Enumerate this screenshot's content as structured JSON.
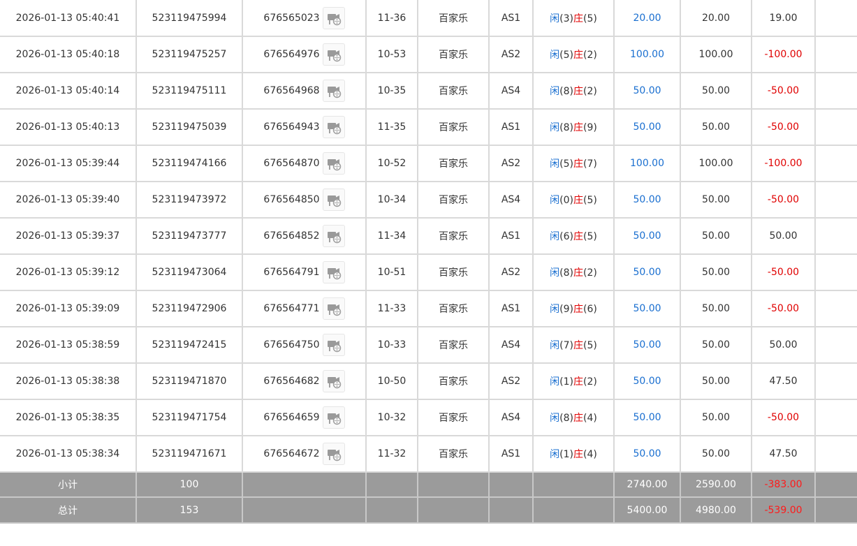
{
  "colors": {
    "blue_value": "#1a6fd0",
    "red_value": "#e00000",
    "summary_bg": "#9b9b9b",
    "border": "#d9d9d9"
  },
  "icons": {
    "replay": "video-replay-icon"
  },
  "rows": [
    {
      "time": "2026-01-13 05:40:41",
      "bet_id": "523119475994",
      "round_id": "676565023",
      "shoe": "11-36",
      "game": "百家乐",
      "table": "AS1",
      "player_label": "闲",
      "player_score": "(3)",
      "banker_label": "庄",
      "banker_score": "(5)",
      "bet": "20.00",
      "valid": "20.00",
      "win_loss": "19.00",
      "win_loss_neg": false
    },
    {
      "time": "2026-01-13 05:40:18",
      "bet_id": "523119475257",
      "round_id": "676564976",
      "shoe": "10-53",
      "game": "百家乐",
      "table": "AS2",
      "player_label": "闲",
      "player_score": "(5)",
      "banker_label": "庄",
      "banker_score": "(2)",
      "bet": "100.00",
      "valid": "100.00",
      "win_loss": "-100.00",
      "win_loss_neg": true
    },
    {
      "time": "2026-01-13 05:40:14",
      "bet_id": "523119475111",
      "round_id": "676564968",
      "shoe": "10-35",
      "game": "百家乐",
      "table": "AS4",
      "player_label": "闲",
      "player_score": "(8)",
      "banker_label": "庄",
      "banker_score": "(2)",
      "bet": "50.00",
      "valid": "50.00",
      "win_loss": "-50.00",
      "win_loss_neg": true
    },
    {
      "time": "2026-01-13 05:40:13",
      "bet_id": "523119475039",
      "round_id": "676564943",
      "shoe": "11-35",
      "game": "百家乐",
      "table": "AS1",
      "player_label": "闲",
      "player_score": "(8)",
      "banker_label": "庄",
      "banker_score": "(9)",
      "bet": "50.00",
      "valid": "50.00",
      "win_loss": "-50.00",
      "win_loss_neg": true
    },
    {
      "time": "2026-01-13 05:39:44",
      "bet_id": "523119474166",
      "round_id": "676564870",
      "shoe": "10-52",
      "game": "百家乐",
      "table": "AS2",
      "player_label": "闲",
      "player_score": "(5)",
      "banker_label": "庄",
      "banker_score": "(7)",
      "bet": "100.00",
      "valid": "100.00",
      "win_loss": "-100.00",
      "win_loss_neg": true
    },
    {
      "time": "2026-01-13 05:39:40",
      "bet_id": "523119473972",
      "round_id": "676564850",
      "shoe": "10-34",
      "game": "百家乐",
      "table": "AS4",
      "player_label": "闲",
      "player_score": "(0)",
      "banker_label": "庄",
      "banker_score": "(5)",
      "bet": "50.00",
      "valid": "50.00",
      "win_loss": "-50.00",
      "win_loss_neg": true
    },
    {
      "time": "2026-01-13 05:39:37",
      "bet_id": "523119473777",
      "round_id": "676564852",
      "shoe": "11-34",
      "game": "百家乐",
      "table": "AS1",
      "player_label": "闲",
      "player_score": "(6)",
      "banker_label": "庄",
      "banker_score": "(5)",
      "bet": "50.00",
      "valid": "50.00",
      "win_loss": "50.00",
      "win_loss_neg": false
    },
    {
      "time": "2026-01-13 05:39:12",
      "bet_id": "523119473064",
      "round_id": "676564791",
      "shoe": "10-51",
      "game": "百家乐",
      "table": "AS2",
      "player_label": "闲",
      "player_score": "(8)",
      "banker_label": "庄",
      "banker_score": "(2)",
      "bet": "50.00",
      "valid": "50.00",
      "win_loss": "-50.00",
      "win_loss_neg": true
    },
    {
      "time": "2026-01-13 05:39:09",
      "bet_id": "523119472906",
      "round_id": "676564771",
      "shoe": "11-33",
      "game": "百家乐",
      "table": "AS1",
      "player_label": "闲",
      "player_score": "(9)",
      "banker_label": "庄",
      "banker_score": "(6)",
      "bet": "50.00",
      "valid": "50.00",
      "win_loss": "-50.00",
      "win_loss_neg": true
    },
    {
      "time": "2026-01-13 05:38:59",
      "bet_id": "523119472415",
      "round_id": "676564750",
      "shoe": "10-33",
      "game": "百家乐",
      "table": "AS4",
      "player_label": "闲",
      "player_score": "(7)",
      "banker_label": "庄",
      "banker_score": "(5)",
      "bet": "50.00",
      "valid": "50.00",
      "win_loss": "50.00",
      "win_loss_neg": false
    },
    {
      "time": "2026-01-13 05:38:38",
      "bet_id": "523119471870",
      "round_id": "676564682",
      "shoe": "10-50",
      "game": "百家乐",
      "table": "AS2",
      "player_label": "闲",
      "player_score": "(1)",
      "banker_label": "庄",
      "banker_score": "(2)",
      "bet": "50.00",
      "valid": "50.00",
      "win_loss": "47.50",
      "win_loss_neg": false
    },
    {
      "time": "2026-01-13 05:38:35",
      "bet_id": "523119471754",
      "round_id": "676564659",
      "shoe": "10-32",
      "game": "百家乐",
      "table": "AS4",
      "player_label": "闲",
      "player_score": "(8)",
      "banker_label": "庄",
      "banker_score": "(4)",
      "bet": "50.00",
      "valid": "50.00",
      "win_loss": "-50.00",
      "win_loss_neg": true
    },
    {
      "time": "2026-01-13 05:38:34",
      "bet_id": "523119471671",
      "round_id": "676564672",
      "shoe": "11-32",
      "game": "百家乐",
      "table": "AS1",
      "player_label": "闲",
      "player_score": "(1)",
      "banker_label": "庄",
      "banker_score": "(4)",
      "bet": "50.00",
      "valid": "50.00",
      "win_loss": "47.50",
      "win_loss_neg": false
    }
  ],
  "subtotal": {
    "label": "小计",
    "count": "100",
    "bet": "2740.00",
    "valid": "2590.00",
    "win_loss": "-383.00"
  },
  "total": {
    "label": "总计",
    "count": "153",
    "bet": "5400.00",
    "valid": "4980.00",
    "win_loss": "-539.00"
  }
}
